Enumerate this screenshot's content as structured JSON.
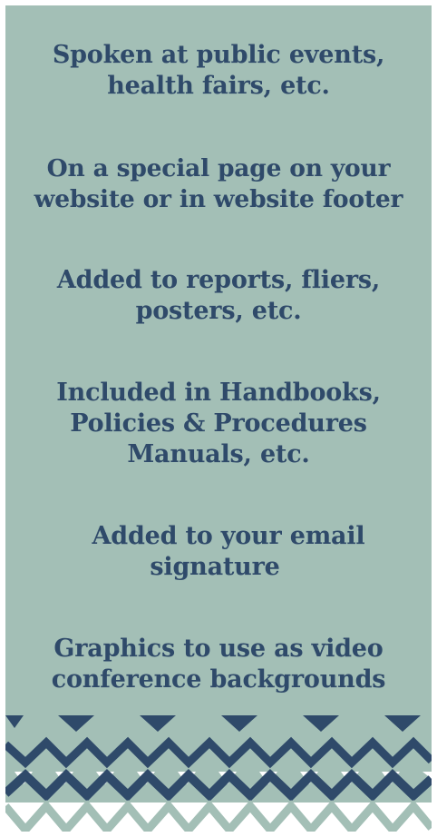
{
  "items": [
    {
      "line1": "Spoken at public events,",
      "line2": "health fairs, etc.",
      "line3": ""
    },
    {
      "line1": "On a special page on your",
      "line2": "website or in website footer",
      "line3": ""
    },
    {
      "line1": "Added to reports, fliers,",
      "line2": "posters, etc.",
      "line3": ""
    },
    {
      "line1": "Included in Handbooks,",
      "line2": "Policies & Procedures",
      "line3": "Manuals, etc."
    },
    {
      "line1": "Added to your email",
      "line2": "signature",
      "line3": ""
    },
    {
      "line1": "Graphics to use as video",
      "line2": "conference backgrounds",
      "line3": ""
    }
  ],
  "colors": {
    "background": "#a3bfb6",
    "text": "#2f4a6a",
    "pattern_dark": "#2f4a6a",
    "pattern_light": "#ffffff"
  },
  "pattern": {
    "icon": "triangle-zigzag-pattern"
  }
}
